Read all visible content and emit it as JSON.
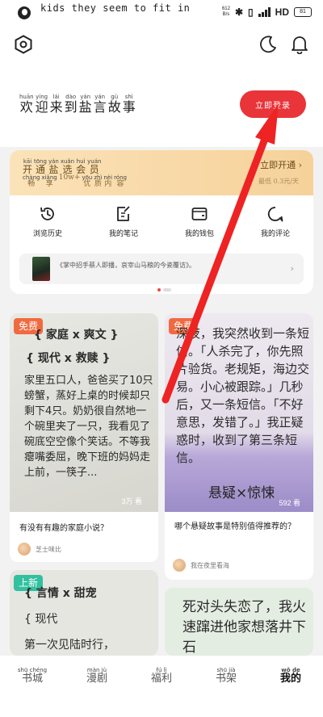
{
  "status_bar": {
    "ticker": "kids they seem to fit in",
    "speed_value": "612",
    "speed_unit": "B/s",
    "network": "HD",
    "battery": "81"
  },
  "header": {
    "welcome": [
      {
        "py": "huān",
        "hz": "欢"
      },
      {
        "py": "yíng",
        "hz": "迎"
      },
      {
        "py": "lái",
        "hz": "来"
      },
      {
        "py": "dào",
        "hz": "到"
      },
      {
        "py": "yán",
        "hz": "盐"
      },
      {
        "py": "yán",
        "hz": "言"
      },
      {
        "py": "gù",
        "hz": "故"
      },
      {
        "py": "shì",
        "hz": "事"
      }
    ],
    "login_label": "立即登录"
  },
  "member": {
    "title": [
      {
        "py": "kāi",
        "hz": "开"
      },
      {
        "py": "tōng",
        "hz": "通"
      },
      {
        "py": "yán",
        "hz": "盐"
      },
      {
        "py": "xuǎn",
        "hz": "选"
      },
      {
        "py": "huì",
        "hz": "会"
      },
      {
        "py": "yuán",
        "hz": "员"
      }
    ],
    "subtitle": [
      {
        "py": "chàng",
        "hz": "畅"
      },
      {
        "py": "xiǎng",
        "hz": "享"
      },
      {
        "py": "",
        "hz": "10w+"
      },
      {
        "py": "yōu",
        "hz": "优"
      },
      {
        "py": "zhì",
        "hz": "质"
      },
      {
        "py": "nèi",
        "hz": "内"
      },
      {
        "py": "róng",
        "hz": "容"
      }
    ],
    "open_label": "立即开通 ›",
    "open_sub": "最低 0.3元/天"
  },
  "quick_links": [
    {
      "icon": "history-icon",
      "label": "浏览历史"
    },
    {
      "icon": "note-icon",
      "label": "我的笔记"
    },
    {
      "icon": "wallet-icon",
      "label": "我的钱包"
    },
    {
      "icon": "comment-icon",
      "label": "我的评论"
    }
  ],
  "recent_read": {
    "text": "《掌中招手蔡人即播，哀宰山马粮的今瓷覆访》。",
    "arrow": "›"
  },
  "cards": [
    {
      "badge": "免费",
      "tags": "{ 家庭 x 爽文 }",
      "subtags": "{ 现代 x 救赎 }",
      "excerpt": "家里五口人，爸爸买了10只螃蟹，蒸好上桌的时候却只剩下4只。奶奶很自然地一个碗里夹了一只，我看见了碗底空空像个笑话。不等我瘪嘴委屈，晚下班的妈妈走上前，一筷子...",
      "reads": "3万 看",
      "question": "有没有有趣的家庭小说？",
      "author": "芝士味比"
    },
    {
      "badge": "免费",
      "excerpt": "深夜，我突然收到一条短信。「人杀完了，你先照片验货。老规矩，海边交易。小心被跟踪。」几秒后，又一条短信。「不好意思，发错了。」我正疑惑时，收到了第三条短信。",
      "genre": "悬疑×惊悚",
      "reads": "592 看",
      "question": "哪个悬疑故事是特别值得推荐的？",
      "author": "我在夜里看海"
    },
    {
      "badge": "上新",
      "tags": "{ 言情 x 甜宠",
      "subtags": "{ 现代",
      "excerpt": "第一次见陆时行，"
    },
    {
      "excerpt": "死对头失恋了，我火速蹿进他家想落井下石"
    }
  ],
  "tabs": [
    {
      "py": "shū chéng",
      "label": "书城",
      "active": false
    },
    {
      "py": "màn jù",
      "label": "漫剧",
      "active": false
    },
    {
      "py": "fú lì",
      "label": "福利",
      "active": false
    },
    {
      "py": "shū jià",
      "label": "书架",
      "active": false
    },
    {
      "py": "wǒ de",
      "label": "我的",
      "active": true
    }
  ],
  "colors": {
    "accent": "#e9343a",
    "arrow": "#ee2323",
    "member_gold": "#f8d8a6"
  }
}
